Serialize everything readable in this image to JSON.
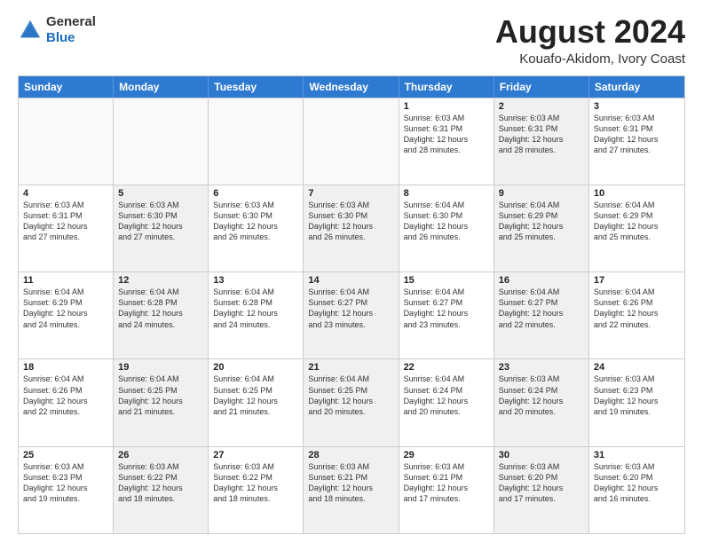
{
  "header": {
    "logo_general": "General",
    "logo_blue": "Blue",
    "month_year": "August 2024",
    "location": "Kouafo-Akidom, Ivory Coast"
  },
  "days_of_week": [
    "Sunday",
    "Monday",
    "Tuesday",
    "Wednesday",
    "Thursday",
    "Friday",
    "Saturday"
  ],
  "weeks": [
    [
      {
        "day": "",
        "text": "",
        "shaded": false,
        "empty": true
      },
      {
        "day": "",
        "text": "",
        "shaded": false,
        "empty": true
      },
      {
        "day": "",
        "text": "",
        "shaded": false,
        "empty": true
      },
      {
        "day": "",
        "text": "",
        "shaded": false,
        "empty": true
      },
      {
        "day": "1",
        "text": "Sunrise: 6:03 AM\nSunset: 6:31 PM\nDaylight: 12 hours\nand 28 minutes.",
        "shaded": false,
        "empty": false
      },
      {
        "day": "2",
        "text": "Sunrise: 6:03 AM\nSunset: 6:31 PM\nDaylight: 12 hours\nand 28 minutes.",
        "shaded": true,
        "empty": false
      },
      {
        "day": "3",
        "text": "Sunrise: 6:03 AM\nSunset: 6:31 PM\nDaylight: 12 hours\nand 27 minutes.",
        "shaded": false,
        "empty": false
      }
    ],
    [
      {
        "day": "4",
        "text": "Sunrise: 6:03 AM\nSunset: 6:31 PM\nDaylight: 12 hours\nand 27 minutes.",
        "shaded": false,
        "empty": false
      },
      {
        "day": "5",
        "text": "Sunrise: 6:03 AM\nSunset: 6:30 PM\nDaylight: 12 hours\nand 27 minutes.",
        "shaded": true,
        "empty": false
      },
      {
        "day": "6",
        "text": "Sunrise: 6:03 AM\nSunset: 6:30 PM\nDaylight: 12 hours\nand 26 minutes.",
        "shaded": false,
        "empty": false
      },
      {
        "day": "7",
        "text": "Sunrise: 6:03 AM\nSunset: 6:30 PM\nDaylight: 12 hours\nand 26 minutes.",
        "shaded": true,
        "empty": false
      },
      {
        "day": "8",
        "text": "Sunrise: 6:04 AM\nSunset: 6:30 PM\nDaylight: 12 hours\nand 26 minutes.",
        "shaded": false,
        "empty": false
      },
      {
        "day": "9",
        "text": "Sunrise: 6:04 AM\nSunset: 6:29 PM\nDaylight: 12 hours\nand 25 minutes.",
        "shaded": true,
        "empty": false
      },
      {
        "day": "10",
        "text": "Sunrise: 6:04 AM\nSunset: 6:29 PM\nDaylight: 12 hours\nand 25 minutes.",
        "shaded": false,
        "empty": false
      }
    ],
    [
      {
        "day": "11",
        "text": "Sunrise: 6:04 AM\nSunset: 6:29 PM\nDaylight: 12 hours\nand 24 minutes.",
        "shaded": false,
        "empty": false
      },
      {
        "day": "12",
        "text": "Sunrise: 6:04 AM\nSunset: 6:28 PM\nDaylight: 12 hours\nand 24 minutes.",
        "shaded": true,
        "empty": false
      },
      {
        "day": "13",
        "text": "Sunrise: 6:04 AM\nSunset: 6:28 PM\nDaylight: 12 hours\nand 24 minutes.",
        "shaded": false,
        "empty": false
      },
      {
        "day": "14",
        "text": "Sunrise: 6:04 AM\nSunset: 6:27 PM\nDaylight: 12 hours\nand 23 minutes.",
        "shaded": true,
        "empty": false
      },
      {
        "day": "15",
        "text": "Sunrise: 6:04 AM\nSunset: 6:27 PM\nDaylight: 12 hours\nand 23 minutes.",
        "shaded": false,
        "empty": false
      },
      {
        "day": "16",
        "text": "Sunrise: 6:04 AM\nSunset: 6:27 PM\nDaylight: 12 hours\nand 22 minutes.",
        "shaded": true,
        "empty": false
      },
      {
        "day": "17",
        "text": "Sunrise: 6:04 AM\nSunset: 6:26 PM\nDaylight: 12 hours\nand 22 minutes.",
        "shaded": false,
        "empty": false
      }
    ],
    [
      {
        "day": "18",
        "text": "Sunrise: 6:04 AM\nSunset: 6:26 PM\nDaylight: 12 hours\nand 22 minutes.",
        "shaded": false,
        "empty": false
      },
      {
        "day": "19",
        "text": "Sunrise: 6:04 AM\nSunset: 6:25 PM\nDaylight: 12 hours\nand 21 minutes.",
        "shaded": true,
        "empty": false
      },
      {
        "day": "20",
        "text": "Sunrise: 6:04 AM\nSunset: 6:25 PM\nDaylight: 12 hours\nand 21 minutes.",
        "shaded": false,
        "empty": false
      },
      {
        "day": "21",
        "text": "Sunrise: 6:04 AM\nSunset: 6:25 PM\nDaylight: 12 hours\nand 20 minutes.",
        "shaded": true,
        "empty": false
      },
      {
        "day": "22",
        "text": "Sunrise: 6:04 AM\nSunset: 6:24 PM\nDaylight: 12 hours\nand 20 minutes.",
        "shaded": false,
        "empty": false
      },
      {
        "day": "23",
        "text": "Sunrise: 6:03 AM\nSunset: 6:24 PM\nDaylight: 12 hours\nand 20 minutes.",
        "shaded": true,
        "empty": false
      },
      {
        "day": "24",
        "text": "Sunrise: 6:03 AM\nSunset: 6:23 PM\nDaylight: 12 hours\nand 19 minutes.",
        "shaded": false,
        "empty": false
      }
    ],
    [
      {
        "day": "25",
        "text": "Sunrise: 6:03 AM\nSunset: 6:23 PM\nDaylight: 12 hours\nand 19 minutes.",
        "shaded": false,
        "empty": false
      },
      {
        "day": "26",
        "text": "Sunrise: 6:03 AM\nSunset: 6:22 PM\nDaylight: 12 hours\nand 18 minutes.",
        "shaded": true,
        "empty": false
      },
      {
        "day": "27",
        "text": "Sunrise: 6:03 AM\nSunset: 6:22 PM\nDaylight: 12 hours\nand 18 minutes.",
        "shaded": false,
        "empty": false
      },
      {
        "day": "28",
        "text": "Sunrise: 6:03 AM\nSunset: 6:21 PM\nDaylight: 12 hours\nand 18 minutes.",
        "shaded": true,
        "empty": false
      },
      {
        "day": "29",
        "text": "Sunrise: 6:03 AM\nSunset: 6:21 PM\nDaylight: 12 hours\nand 17 minutes.",
        "shaded": false,
        "empty": false
      },
      {
        "day": "30",
        "text": "Sunrise: 6:03 AM\nSunset: 6:20 PM\nDaylight: 12 hours\nand 17 minutes.",
        "shaded": true,
        "empty": false
      },
      {
        "day": "31",
        "text": "Sunrise: 6:03 AM\nSunset: 6:20 PM\nDaylight: 12 hours\nand 16 minutes.",
        "shaded": false,
        "empty": false
      }
    ]
  ]
}
